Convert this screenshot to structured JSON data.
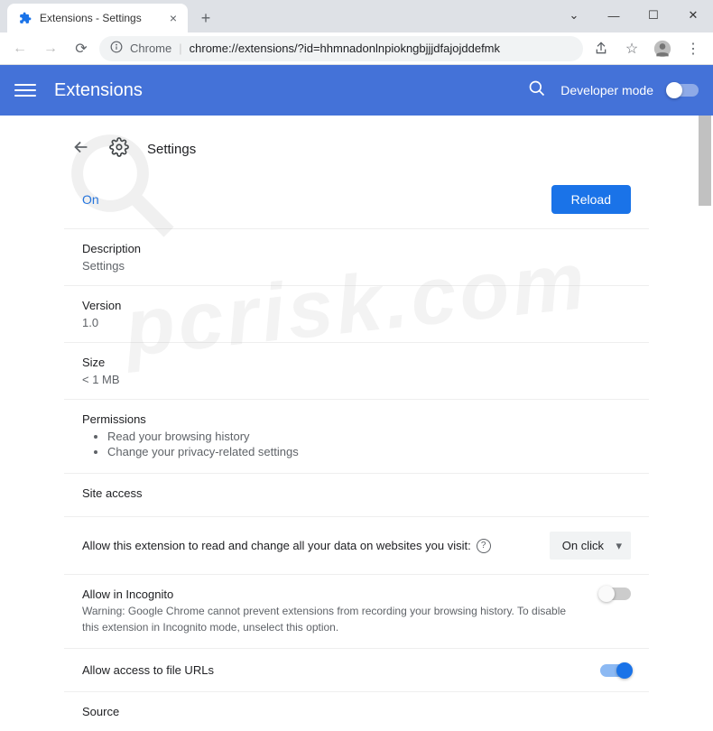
{
  "browser": {
    "tab_title": "Extensions - Settings",
    "omnibox_prefix": "Chrome",
    "omnibox_path": "chrome://extensions/?id=hhmnadonlnpiokngbjjjdfajojddefmk"
  },
  "header": {
    "title": "Extensions",
    "dev_mode_label": "Developer mode"
  },
  "detail": {
    "page_title": "Settings",
    "on_label": "On",
    "reload_label": "Reload",
    "description_label": "Description",
    "description_value": "Settings",
    "version_label": "Version",
    "version_value": "1.0",
    "size_label": "Size",
    "size_value": "< 1 MB",
    "permissions_label": "Permissions",
    "permissions": [
      "Read your browsing history",
      "Change your privacy-related settings"
    ],
    "site_access_label": "Site access",
    "site_access_text": "Allow this extension to read and change all your data on websites you visit:",
    "site_access_value": "On click",
    "incognito_label": "Allow in Incognito",
    "incognito_warning": "Warning: Google Chrome cannot prevent extensions from recording your browsing history. To disable this extension in Incognito mode, unselect this option.",
    "file_urls_label": "Allow access to file URLs",
    "source_label": "Source"
  }
}
